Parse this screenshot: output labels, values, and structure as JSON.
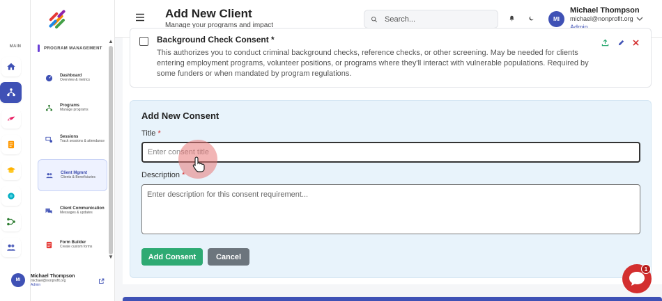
{
  "header": {
    "title": "Add New Client",
    "subtitle": "Manage your programs and impact",
    "search_placeholder": "Search...",
    "user_name": "Michael Thompson",
    "user_email": "michael@nonprofit.org",
    "user_role": "Admin",
    "user_initials": "MI"
  },
  "rail": {
    "label": "MAIN",
    "items": [
      {
        "icon": "home-icon",
        "color": "#3f51b5"
      },
      {
        "icon": "programs-icon",
        "color": "#ffffff",
        "active": true
      },
      {
        "icon": "sessions-icon",
        "color": "#e91e63"
      },
      {
        "icon": "document-icon",
        "color": "#ff9800"
      },
      {
        "icon": "graduation-icon",
        "color": "#ffb300"
      },
      {
        "icon": "globe-icon",
        "color": "#00acc1"
      },
      {
        "icon": "network-icon",
        "color": "#2e7d32"
      },
      {
        "icon": "group-icon",
        "color": "#3f51b5"
      }
    ]
  },
  "sidebar": {
    "section": "PROGRAM MANAGEMENT",
    "items": [
      {
        "label": "Dashboard",
        "desc": "Overview & metrics",
        "icon": "dashboard-icon"
      },
      {
        "label": "Programs",
        "desc": "Manage programs",
        "icon": "programs-icon"
      },
      {
        "label": "Sessions",
        "desc": "Track sessions & attendance",
        "icon": "sessions-icon"
      },
      {
        "label": "Client Mgmnt",
        "desc": "Clients & Beneficiaries",
        "icon": "clients-icon",
        "active": true
      },
      {
        "label": "Client Communication",
        "desc": "Messages & updates",
        "icon": "chat-icon"
      },
      {
        "label": "Form Builder",
        "desc": "Create custom forms",
        "icon": "form-icon"
      }
    ],
    "user_name": "Michael Thompson",
    "user_email": "michael@nonprofit.org",
    "user_role": "Admin",
    "user_initials": "MI"
  },
  "consent": {
    "title": "Background Check Consent *",
    "description": "This authorizes you to conduct criminal background checks, reference checks, or other screening. May be needed for clients entering employment programs, volunteer positions, or programs where they'll interact with vulnerable populations. Required by some funders or when mandated by program regulations."
  },
  "add_consent": {
    "heading": "Add New Consent",
    "title_label": "Title",
    "title_placeholder": "Enter consent title",
    "description_label": "Description",
    "description_placeholder": "Enter description for this consent requirement...",
    "required_mark": "*",
    "add_button": "Add Consent",
    "cancel_button": "Cancel"
  },
  "chat": {
    "badge": "1"
  },
  "colors": {
    "accent": "#3f51b5",
    "success": "#2eaa73",
    "danger": "#d32f2f",
    "panel": "#e8f3fb"
  }
}
